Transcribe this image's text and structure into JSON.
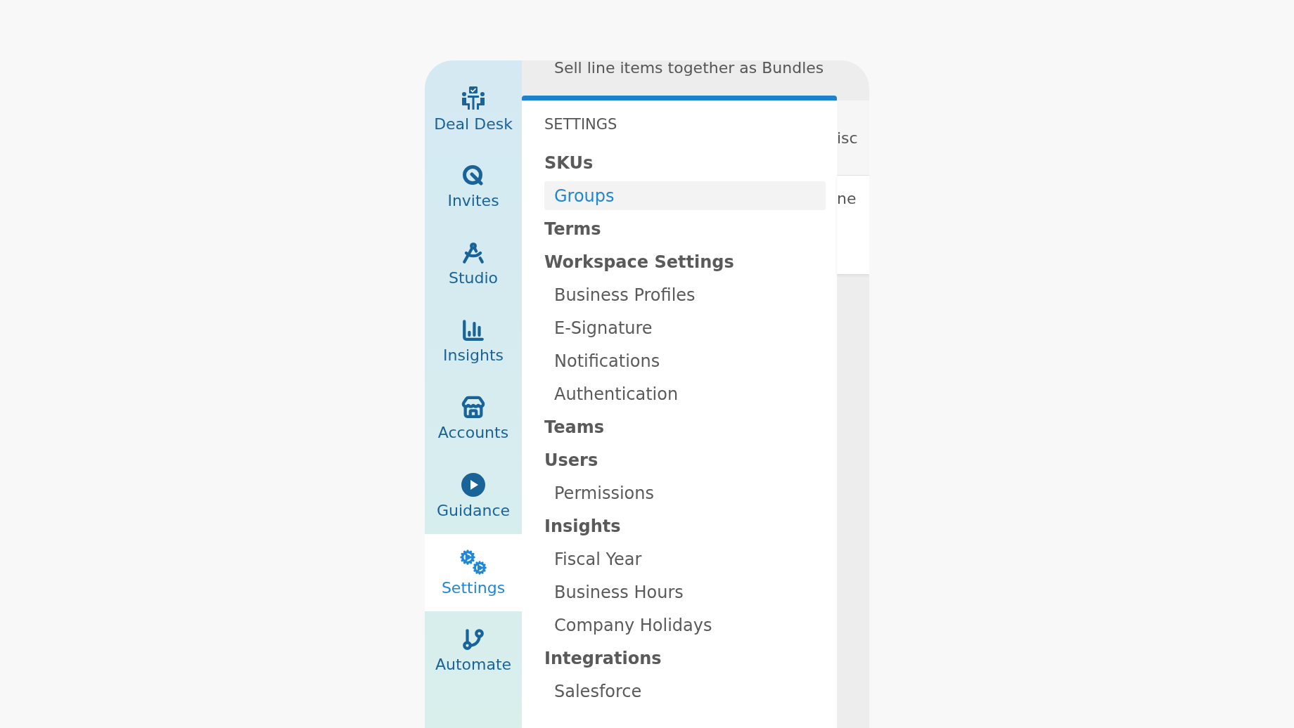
{
  "sidebar": {
    "items": [
      {
        "label": "Deal Desk",
        "selected": false
      },
      {
        "label": "Invites",
        "selected": false
      },
      {
        "label": "Studio",
        "selected": false
      },
      {
        "label": "Insights",
        "selected": false
      },
      {
        "label": "Accounts",
        "selected": false
      },
      {
        "label": "Guidance",
        "selected": false
      },
      {
        "label": "Settings",
        "selected": true
      },
      {
        "label": "Automate",
        "selected": false
      }
    ]
  },
  "background": {
    "description": "Sell line items together as Bundles",
    "column_1": "isc",
    "column_2": "ne"
  },
  "settings_panel": {
    "title": "SETTINGS",
    "sections": [
      {
        "label": "SKUs",
        "selected": false,
        "children": [
          {
            "label": "Groups",
            "selected": true
          }
        ]
      },
      {
        "label": "Terms",
        "selected": false
      },
      {
        "label": "Workspace Settings",
        "selected": false,
        "children": [
          {
            "label": "Business Profiles",
            "selected": false
          },
          {
            "label": "E-Signature",
            "selected": false
          },
          {
            "label": "Notifications",
            "selected": false
          },
          {
            "label": "Authentication",
            "selected": false
          }
        ]
      },
      {
        "label": "Teams",
        "selected": false
      },
      {
        "label": "Users",
        "selected": false,
        "children": [
          {
            "label": "Permissions",
            "selected": false
          }
        ]
      },
      {
        "label": "Insights",
        "selected": false,
        "children": [
          {
            "label": "Fiscal Year",
            "selected": false
          },
          {
            "label": "Business Hours",
            "selected": false
          },
          {
            "label": "Company Holidays",
            "selected": false
          }
        ]
      },
      {
        "label": "Integrations",
        "selected": false,
        "children": [
          {
            "label": "Salesforce",
            "selected": false
          }
        ]
      }
    ]
  }
}
